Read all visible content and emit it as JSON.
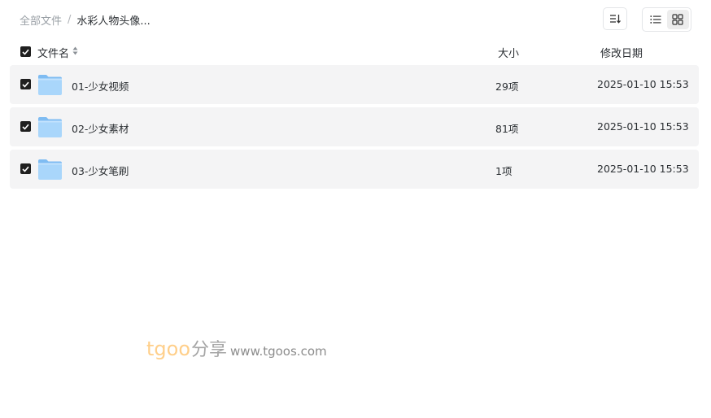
{
  "breadcrumb": {
    "root": "全部文件",
    "separator": "/",
    "current": "水彩人物头像..."
  },
  "toolbar": {
    "sort_icon": "sort-lines-icon",
    "list_view_icon": "list-icon",
    "grid_view_icon": "grid-icon",
    "active_view": "grid"
  },
  "table": {
    "columns": {
      "name": "文件名",
      "size": "大小",
      "modified": "修改日期"
    },
    "select_all_checked": true,
    "rows": [
      {
        "name": "01-少女视频",
        "size": "29项",
        "modified": "2025-01-10 15:53",
        "checked": true,
        "icon": "folder-icon"
      },
      {
        "name": "02-少女素材",
        "size": "81项",
        "modified": "2025-01-10 15:53",
        "checked": true,
        "icon": "folder-icon"
      },
      {
        "name": "03-少女笔刷",
        "size": "1项",
        "modified": "2025-01-10 15:53",
        "checked": true,
        "icon": "folder-icon"
      }
    ]
  },
  "watermark": {
    "brand": "tgoo",
    "share": "分享",
    "url": "www.tgoos.com"
  },
  "colors": {
    "row_background": "#f4f4f5",
    "checkbox": "#1f1f1f",
    "folder_light": "#a9d6fb",
    "folder_dark": "#7fbcf2",
    "watermark_brand": "#ffcf8a"
  }
}
